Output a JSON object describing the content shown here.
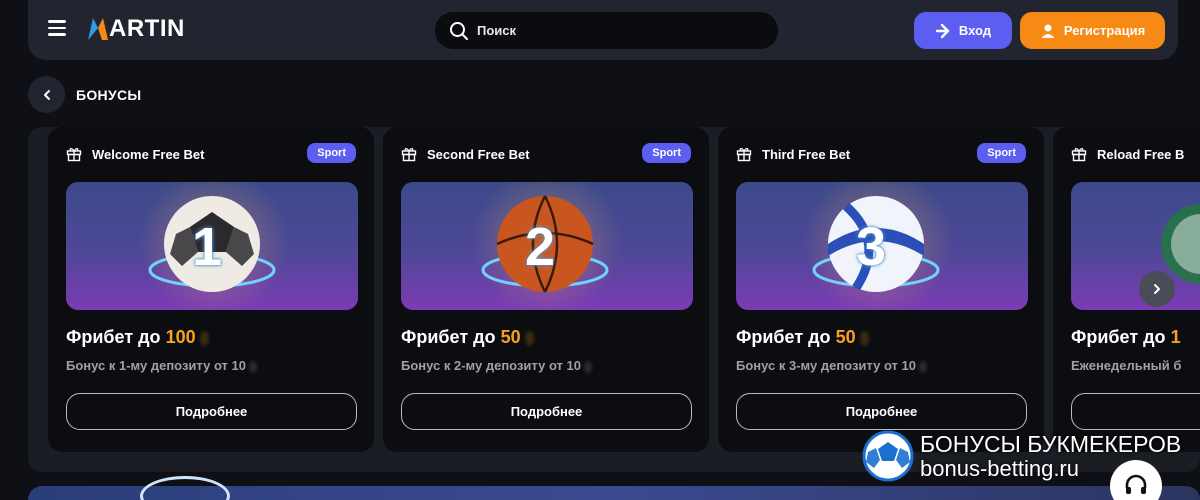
{
  "header": {
    "logo_text": "MARTIN",
    "search_placeholder": "Поиск",
    "login_label": "Вход",
    "register_label": "Регистрация"
  },
  "page": {
    "title": "БОНУСЫ"
  },
  "cards": [
    {
      "name": "Welcome Free Bet",
      "badge": "Sport",
      "number": "1",
      "title_prefix": "Фрибет до",
      "amount": "100",
      "subtitle": "Бонус к 1-му депозиту от 10",
      "button": "Подробнее"
    },
    {
      "name": "Second Free Bet",
      "badge": "Sport",
      "number": "2",
      "title_prefix": "Фрибет до",
      "amount": "50",
      "subtitle": "Бонус к 2-му депозиту от 10",
      "button": "Подробнее"
    },
    {
      "name": "Third Free Bet",
      "badge": "Sport",
      "number": "3",
      "title_prefix": "Фрибет до",
      "amount": "50",
      "subtitle": "Бонус к 3-му депозиту от 10",
      "button": "Подробнее"
    },
    {
      "name": "Reload Free B",
      "title_prefix": "Фрибет до",
      "amount": "1",
      "subtitle": "Еженедельный б"
    }
  ],
  "watermark": {
    "line1": "БОНУСЫ БУКМЕКЕРОВ",
    "line2": "bonus-betting.ru"
  },
  "colors": {
    "accent_blue": "#5b5ef0",
    "accent_orange": "#f68a14",
    "amount": "#f6a21a"
  }
}
